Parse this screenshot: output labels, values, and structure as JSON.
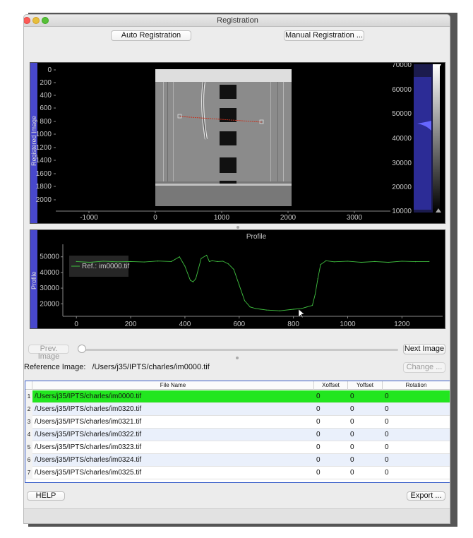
{
  "window": {
    "title": "Registration"
  },
  "toolbar": {
    "auto_label": "Auto Registration",
    "manual_label": "Manual Registration ..."
  },
  "image_view": {
    "side_label": "Registered Image",
    "y_ticks": [
      "0",
      "200",
      "400",
      "600",
      "800",
      "1000",
      "1200",
      "1400",
      "1600",
      "1800",
      "2000"
    ],
    "x_ticks": [
      "-1000",
      "0",
      "1000",
      "2000",
      "3000"
    ],
    "hist_ticks": [
      "70000",
      "60000",
      "50000",
      "40000",
      "30000",
      "20000",
      "10000"
    ]
  },
  "profile_view": {
    "side_label": "Profile",
    "title": "Profile",
    "legend": "Ref.: im0000.tif",
    "line_color": "#3fbf3f"
  },
  "chart_data": {
    "type": "line",
    "title": "Profile",
    "ylabel": "Profile",
    "xlabel": "",
    "xlim": [
      -50,
      1350
    ],
    "ylim": [
      12000,
      58000
    ],
    "x_ticks": [
      0,
      200,
      400,
      600,
      800,
      1000,
      1200
    ],
    "y_ticks": [
      20000,
      30000,
      40000,
      50000
    ],
    "series": [
      {
        "name": "Ref.: im0000.tif",
        "color": "#3fbf3f",
        "x": [
          0,
          50,
          100,
          150,
          200,
          250,
          300,
          350,
          380,
          400,
          420,
          430,
          440,
          460,
          480,
          490,
          500,
          520,
          540,
          560,
          580,
          600,
          620,
          640,
          660,
          680,
          700,
          750,
          800,
          830,
          850,
          870,
          880,
          890,
          900,
          920,
          950,
          1000,
          1050,
          1100,
          1150,
          1200,
          1250,
          1300
        ],
        "y": [
          47000,
          46500,
          47200,
          46800,
          47000,
          46700,
          47300,
          47000,
          50000,
          44000,
          35000,
          34000,
          36000,
          49000,
          51000,
          47000,
          47500,
          47000,
          47200,
          45500,
          42000,
          32000,
          22000,
          18000,
          17000,
          16500,
          16000,
          15500,
          16500,
          17000,
          18000,
          19000,
          26000,
          36000,
          45000,
          47500,
          46800,
          47200,
          46500,
          47000,
          46500,
          47200,
          46900,
          47000
        ]
      }
    ]
  },
  "navigation": {
    "prev_label": "Prev. Image",
    "next_label": "Next Image"
  },
  "reference": {
    "label": "Reference Image:",
    "path": "/Users/j35/IPTS/charles/im0000.tif",
    "change_label": "Change ..."
  },
  "table": {
    "headers": [
      "File Name",
      "Xoffset",
      "Yoffset",
      "Rotation"
    ],
    "rows": [
      {
        "num": "1",
        "file": "/Users/j35/IPTS/charles/im0000.tif",
        "x": "0",
        "y": "0",
        "rot": "0"
      },
      {
        "num": "2",
        "file": "/Users/j35/IPTS/charles/im0320.tif",
        "x": "0",
        "y": "0",
        "rot": "0"
      },
      {
        "num": "3",
        "file": "/Users/j35/IPTS/charles/im0321.tif",
        "x": "0",
        "y": "0",
        "rot": "0"
      },
      {
        "num": "4",
        "file": "/Users/j35/IPTS/charles/im0322.tif",
        "x": "0",
        "y": "0",
        "rot": "0"
      },
      {
        "num": "5",
        "file": "/Users/j35/IPTS/charles/im0323.tif",
        "x": "0",
        "y": "0",
        "rot": "0"
      },
      {
        "num": "6",
        "file": "/Users/j35/IPTS/charles/im0324.tif",
        "x": "0",
        "y": "0",
        "rot": "0"
      },
      {
        "num": "7",
        "file": "/Users/j35/IPTS/charles/im0325.tif",
        "x": "0",
        "y": "0",
        "rot": "0"
      }
    ],
    "selected_color": "#22e61f",
    "alt_color": "#eaf0fb"
  },
  "footer": {
    "help_label": "HELP",
    "export_label": "Export ..."
  },
  "colors": {
    "accent_blue": "#4848cc",
    "panel_bg": "#000000"
  }
}
